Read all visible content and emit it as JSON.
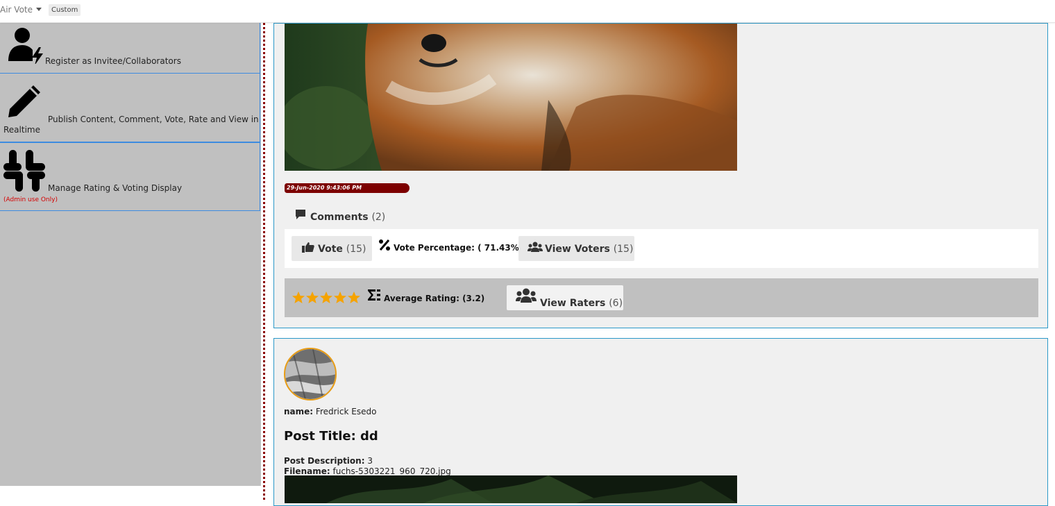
{
  "topbar": {
    "app_title": "Air Vote",
    "custom_badge": "Custom"
  },
  "sidebar": {
    "items": [
      {
        "label": "Register as Invitee/Collaborators",
        "icon": "user-bolt-icon"
      },
      {
        "label": "Publish Content, Comment, Vote, Rate and View in Realtime",
        "label_line1": "Publish Content, Comment, Vote, Rate and View in",
        "label_line2": "Realtime",
        "icon": "pencil-icon"
      },
      {
        "label": "Manage Rating & Voting Display",
        "note": "(Admin use Only)",
        "icon": "slack-icon"
      }
    ],
    "colors": {
      "background": "#c0c0c0",
      "border": "#3d8be0",
      "note": "#d40000"
    }
  },
  "post1": {
    "date": "29-Jun-2020 9:43:06 PM",
    "comments": {
      "label": "Comments",
      "count": "(2)"
    },
    "vote": {
      "label": "Vote",
      "count": "(15)"
    },
    "vote_percentage": {
      "label": "Vote Percentage:",
      "value": "( 71.43%)"
    },
    "view_voters": {
      "label": "View Voters",
      "count": "(15)"
    },
    "rating": {
      "stars": 5,
      "label": "Average Rating:",
      "value": "(3.2)"
    },
    "view_raters": {
      "label": "View Raters",
      "count": "(6)"
    }
  },
  "post2": {
    "name_label": "name:",
    "name_value": "Fredrick Esedo",
    "title": "Post Title: dd",
    "description_label": "Post Description:",
    "description_value": "3",
    "filename_label": "Filename:",
    "filename_value": "fuchs-5303221_960_720.jpg"
  },
  "colors": {
    "card_border": "#2a98c8",
    "date_badge": "#7d0000",
    "star": "#f5a300",
    "avatar_ring": "#e89c14",
    "divider": "#8b0000"
  }
}
